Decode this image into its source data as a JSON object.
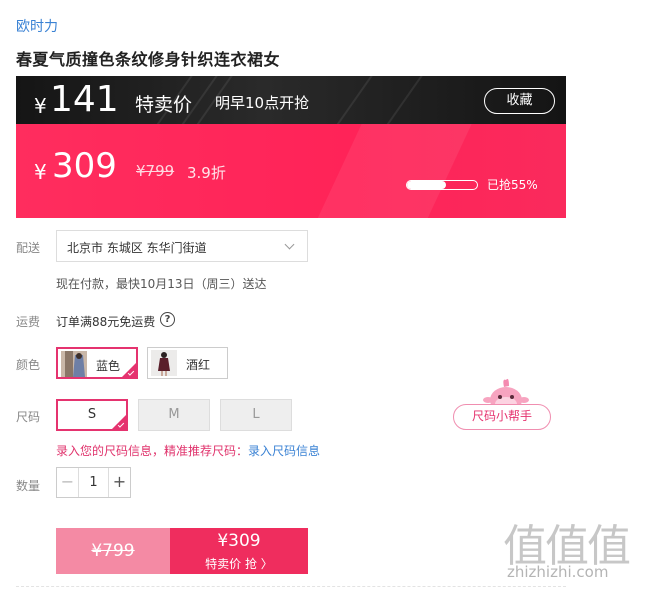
{
  "product": {
    "brand": "欧时力",
    "title": "春夏气质撞色条纹修身针织连衣裙女"
  },
  "flash_sale": {
    "currency": "¥",
    "price": "141",
    "label": "特卖价",
    "start_time": "明早10点开抢",
    "favorite_label": "收藏"
  },
  "pricing": {
    "currency": "¥",
    "current_price": "309",
    "original_price": "¥799",
    "discount": "3.9折",
    "sold_progress": 0.55,
    "sold_text": "已抢55%"
  },
  "delivery": {
    "label": "配送",
    "address": "北京市 东城区 东华门街道",
    "note": "现在付款，最快10月13日（周三）送达"
  },
  "shipping": {
    "label": "运费",
    "text": "订单满88元免运费",
    "help_glyph": "?"
  },
  "color": {
    "label": "颜色",
    "options": [
      {
        "label": "蓝色",
        "selected": true
      },
      {
        "label": "酒红",
        "selected": false
      }
    ]
  },
  "size": {
    "label": "尺码",
    "options": [
      {
        "label": "S",
        "selected": true
      },
      {
        "label": "M",
        "selected": false
      },
      {
        "label": "L",
        "selected": false
      }
    ],
    "hint": "录入您的尺码信息，精准推荐尺码：",
    "hint_link": "录入尺码信息",
    "helper_label": "尺码小帮手"
  },
  "quantity": {
    "label": "数量",
    "value": "1",
    "minus": "−",
    "plus": "+"
  },
  "buy": {
    "original_price": "¥799",
    "sale_price": "¥309",
    "sale_label": "特卖价 抢 〉"
  },
  "watermark": {
    "logo": "值值值",
    "site": "zhizhizhi.com"
  },
  "colors": {
    "accent": "#e5336f",
    "sale_band": "#ff2d5e",
    "dark_band": "#1a1a1a",
    "link": "#3a82d4"
  }
}
